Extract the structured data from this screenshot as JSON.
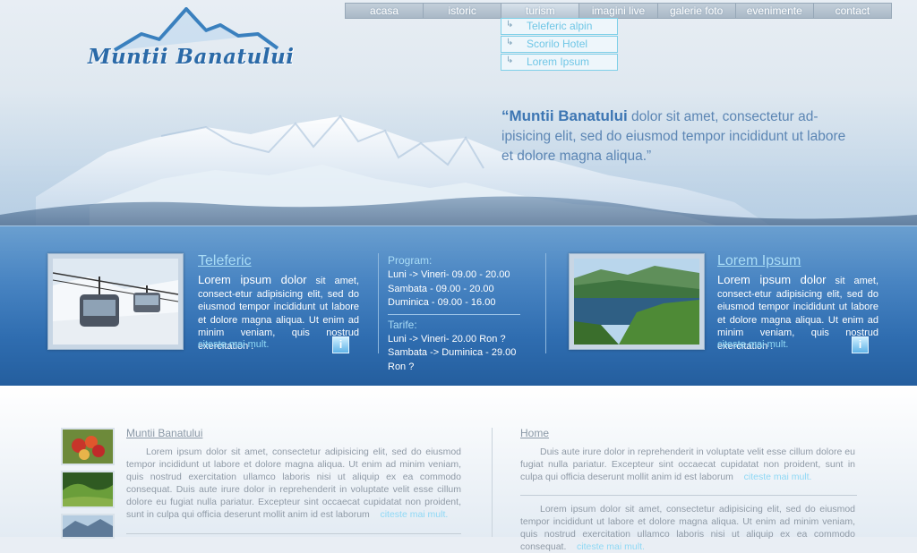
{
  "brand": {
    "name": "Muntii Banatului"
  },
  "nav": {
    "items": [
      "acasa",
      "istoric",
      "turism",
      "imagini live",
      "galerie foto",
      "evenimente",
      "contact"
    ],
    "active": "turism"
  },
  "dropdown": {
    "items": [
      "Teleferic alpin",
      "Scorilo Hotel",
      "Lorem Ipsum"
    ]
  },
  "hero_quote": {
    "lead": "“Muntii Banatului",
    "text": " dolor sit amet, consectetur ad-ipisicing elit, sed do eiusmod tempor incididunt ut labore et dolore magna aliqua.”"
  },
  "band": {
    "left": {
      "title": "Teleferic",
      "lead": "Lorem ipsum dolor",
      "text": " sit amet, consect-etur adipisicing elit, sed do eiusmod tempor incididunt ut labore et dolore magna aliqua. Ut enim ad minim veniam, quis nostrud exercitation .",
      "more": "citeste mai mult."
    },
    "program": {
      "head": "Program:",
      "lines": [
        "Luni -> Vineri- 09.00 - 20.00",
        "Sambata - 09.00 - 20.00",
        "Duminica - 09.00 - 16.00"
      ],
      "tarif_head": "Tarife:",
      "tarif_lines": [
        "Luni -> Vineri- 20.00 Ron ?",
        "Sambata -> Duminica - 29.00 Ron ?"
      ]
    },
    "right": {
      "title": "Lorem Ipsum",
      "lead": "Lorem ipsum dolor",
      "text": " sit amet, consect-etur adipisicing elit, sed do eiusmod tempor incididunt ut labore et dolore magna aliqua. Ut enim ad minim veniam, quis nostrud exercitation .",
      "more": "citeste mai mult."
    },
    "info_icon_glyph": "i"
  },
  "content": {
    "left": {
      "title": "Muntii Banatului",
      "text": "Lorem ipsum dolor sit amet, consectetur adipisicing elit, sed do eiusmod tempor incididunt ut labore et dolore magna aliqua. Ut enim ad minim veniam, quis nostrud exercitation ullamco laboris nisi ut aliquip ex ea commodo consequat. Duis aute irure dolor in reprehenderit in voluptate velit esse cillum dolore eu fugiat nulla pariatur. Excepteur sint occaecat cupidatat non proident, sunt in culpa qui officia deserunt mollit anim id est laborum",
      "more": "citeste mai mult."
    },
    "right": {
      "title": "Home",
      "text1": "Duis aute irure dolor in reprehenderit in voluptate velit esse cillum dolore eu fugiat nulla pariatur. Excepteur sint occaecat cupidatat non proident, sunt in culpa qui officia deserunt mollit anim id est laborum",
      "more1": "citeste mai mult.",
      "text2": "Lorem ipsum dolor sit amet, consectetur adipisicing elit, sed do eiusmod tempor incididunt ut labore et dolore magna aliqua. Ut enim ad minim veniam, quis nostrud exercitation ullamco laboris nisi ut aliquip ex ea commodo consequat.",
      "more2": "citeste mai mult."
    }
  },
  "colors": {
    "band": "#3a78b9",
    "accent_link": "#8fd8f5",
    "brand": "#2b6aa8"
  }
}
